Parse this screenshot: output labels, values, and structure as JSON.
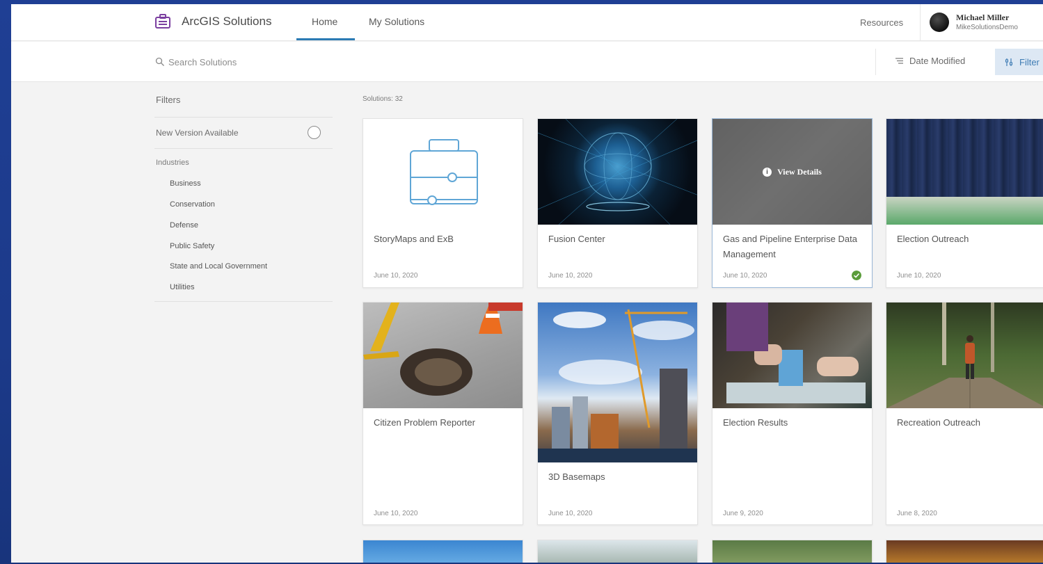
{
  "header": {
    "app_name": "ArcGIS Solutions",
    "tabs": [
      "Home",
      "My Solutions"
    ],
    "active_tab": "Home",
    "resources": "Resources",
    "user": {
      "name": "Michael Miller",
      "handle": "MikeSolutionsDemo"
    }
  },
  "toolbar": {
    "search_placeholder": "Search Solutions",
    "sort_label": "Date Modified",
    "filter_label": "Filter"
  },
  "sidebar": {
    "title": "Filters",
    "new_version_label": "New Version Available",
    "industries_label": "Industries",
    "industries": [
      "Business",
      "Conservation",
      "Defense",
      "Public Safety",
      "State and Local Government",
      "Utilities"
    ]
  },
  "main": {
    "count_label": "Solutions: 32",
    "cards": [
      {
        "title": "StoryMaps and ExB",
        "date": "June 10, 2020"
      },
      {
        "title": "Fusion Center",
        "date": "June 10, 2020"
      },
      {
        "title": "Gas and Pipeline Enterprise Data Management",
        "date": "June 10, 2020",
        "hover_label": "View Details",
        "installed": true
      },
      {
        "title": "Election Outreach",
        "date": "June 10, 2020"
      },
      {
        "title": "Citizen Problem Reporter",
        "date": "June 10, 2020"
      },
      {
        "title": "3D Basemaps",
        "date": "June 10, 2020"
      },
      {
        "title": "Election Results",
        "date": "June 9, 2020"
      },
      {
        "title": "Recreation Outreach",
        "date": "June 8, 2020"
      }
    ]
  },
  "colors": {
    "accent": "#2b7bb4",
    "brand_icon": "#7b3fa0",
    "check": "#5a9c3a",
    "frame": "#1f3f94"
  },
  "icons": [
    "solutions-logo-icon",
    "search-icon",
    "sort-icon",
    "filter-icon",
    "toggle-icon",
    "info-icon",
    "check-icon",
    "briefcase-icon"
  ]
}
